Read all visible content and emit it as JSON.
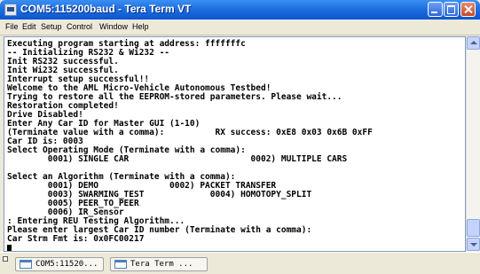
{
  "window": {
    "title": "COM5:115200baud - Tera Term VT"
  },
  "menu": [
    {
      "label": "File"
    },
    {
      "label": "Edit"
    },
    {
      "label": "Setup"
    },
    {
      "label": "Control"
    },
    {
      "label": "Window"
    },
    {
      "label": "Help"
    }
  ],
  "terminal": {
    "lines": [
      "Executing program starting at address: fffffffc",
      "-- Initializing RS232 & Wi232 --",
      "Init RS232 successful.",
      "Init Wi232 successful.",
      "Interrupt setup successful!!",
      "Welcome to the AML Micro-Vehicle Autonomous Testbed!",
      "Trying to restore all the EEPROM-stored parameters. Please wait...",
      "Restoration completed!",
      "Drive Disabled!",
      "Enter Any Car ID for Master GUI (1-10)",
      "(Terminate value with a comma):          RX success: 0xE8 0x03 0x6B 0xFF",
      "Car ID is: 0003",
      "Select Operating Mode (Terminate with a comma):",
      "        0001) SINGLE CAR                        0002) MULTIPLE CARS",
      "",
      "Select an Algorithm (Terminate with a comma):",
      "        0001) DEMO              0002) PACKET TRANSFER",
      "        0003) SWARMING_TEST             0004) HOMOTOPY_SPLIT",
      "        0005) PEER_TO_PEER",
      "        0006) IR_Sensor",
      ": Entering REU Testing Algorithm...",
      "Please enter largest Car ID number (Terminate with a comma):",
      "Car Strm Fmt is: 0x0FC00217"
    ]
  },
  "taskbar": {
    "items": [
      {
        "label": "COM5:11520..."
      },
      {
        "label": "Tera Term ..."
      }
    ]
  },
  "icons": {
    "app": "tera-term-icon",
    "minimize": "minimize-icon",
    "maximize": "maximize-icon",
    "close": "close-icon"
  },
  "colors": {
    "titlebar": "#0b55d0",
    "terminal_bg": "#ffffff",
    "terminal_fg": "#000000"
  }
}
